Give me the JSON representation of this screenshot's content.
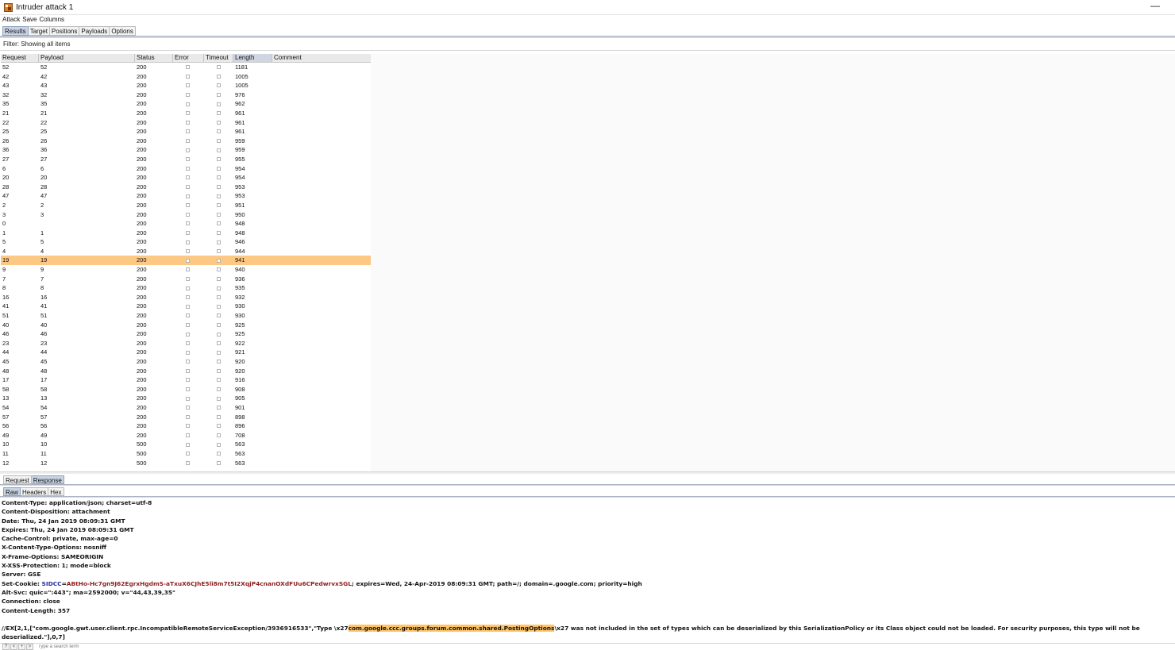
{
  "window": {
    "title": "Intruder attack 1",
    "minimize_label": "—"
  },
  "menu": [
    "Attack",
    "Save",
    "Columns"
  ],
  "tabs": [
    "Results",
    "Target",
    "Positions",
    "Payloads",
    "Options"
  ],
  "filter_text": "Filter: Showing all items",
  "table": {
    "columns": [
      "Request",
      "Payload",
      "Status",
      "Error",
      "Timeout",
      "Length",
      "Comment"
    ],
    "sorted_column": "Length",
    "selected_request": "19",
    "rows": [
      [
        "52",
        "52",
        "200",
        "1181"
      ],
      [
        "42",
        "42",
        "200",
        "1005"
      ],
      [
        "43",
        "43",
        "200",
        "1005"
      ],
      [
        "32",
        "32",
        "200",
        "976"
      ],
      [
        "35",
        "35",
        "200",
        "962"
      ],
      [
        "21",
        "21",
        "200",
        "961"
      ],
      [
        "22",
        "22",
        "200",
        "961"
      ],
      [
        "25",
        "25",
        "200",
        "961"
      ],
      [
        "26",
        "26",
        "200",
        "959"
      ],
      [
        "36",
        "36",
        "200",
        "959"
      ],
      [
        "27",
        "27",
        "200",
        "955"
      ],
      [
        "6",
        "6",
        "200",
        "954"
      ],
      [
        "20",
        "20",
        "200",
        "954"
      ],
      [
        "28",
        "28",
        "200",
        "953"
      ],
      [
        "47",
        "47",
        "200",
        "953"
      ],
      [
        "2",
        "2",
        "200",
        "951"
      ],
      [
        "3",
        "3",
        "200",
        "950"
      ],
      [
        "0",
        "",
        "200",
        "948"
      ],
      [
        "1",
        "1",
        "200",
        "948"
      ],
      [
        "5",
        "5",
        "200",
        "946"
      ],
      [
        "4",
        "4",
        "200",
        "944"
      ],
      [
        "19",
        "19",
        "200",
        "941"
      ],
      [
        "9",
        "9",
        "200",
        "940"
      ],
      [
        "7",
        "7",
        "200",
        "936"
      ],
      [
        "8",
        "8",
        "200",
        "935"
      ],
      [
        "16",
        "16",
        "200",
        "932"
      ],
      [
        "41",
        "41",
        "200",
        "930"
      ],
      [
        "51",
        "51",
        "200",
        "930"
      ],
      [
        "40",
        "40",
        "200",
        "925"
      ],
      [
        "46",
        "46",
        "200",
        "925"
      ],
      [
        "23",
        "23",
        "200",
        "922"
      ],
      [
        "44",
        "44",
        "200",
        "921"
      ],
      [
        "45",
        "45",
        "200",
        "920"
      ],
      [
        "48",
        "48",
        "200",
        "920"
      ],
      [
        "17",
        "17",
        "200",
        "916"
      ],
      [
        "58",
        "58",
        "200",
        "908"
      ],
      [
        "13",
        "13",
        "200",
        "905"
      ],
      [
        "54",
        "54",
        "200",
        "901"
      ],
      [
        "57",
        "57",
        "200",
        "898"
      ],
      [
        "56",
        "56",
        "200",
        "896"
      ],
      [
        "49",
        "49",
        "200",
        "708"
      ],
      [
        "10",
        "10",
        "500",
        "563"
      ],
      [
        "11",
        "11",
        "500",
        "563"
      ],
      [
        "12",
        "12",
        "500",
        "563"
      ]
    ]
  },
  "message_tabs": [
    "Request",
    "Response"
  ],
  "view_tabs": [
    "Raw",
    "Headers",
    "Hex"
  ],
  "response": {
    "headers": [
      "Content-Type: application/json; charset=utf-8",
      "Content-Disposition: attachment",
      "Date: Thu, 24 Jan 2019 08:09:31 GMT",
      "Expires: Thu, 24 Jan 2019 08:09:31 GMT",
      "Cache-Control: private, max-age=0",
      "X-Content-Type-Options: nosniff",
      "X-Frame-Options: SAMEORIGIN",
      "X-XSS-Protection: 1; mode=block",
      "Server: GSE"
    ],
    "cookie": {
      "prefix": "Set-Cookie: ",
      "name": "SIDCC",
      "eq": "=",
      "value": "ABtHo-Hc7gn9J62EgrxHgdmS-aTxuX6CJhE5li8m7t5I2XqjP4cnanOXdFUu6CPedwrvxSGL",
      "rest": "; expires=Wed, 24-Apr-2019 08:09:31 GMT; path=/; domain=.google.com; priority=high"
    },
    "headers_after": [
      "Alt-Svc: quic=\":443\"; ma=2592000; v=\"44,43,39,35\"",
      "Connection: close",
      "Content-Length: 357"
    ],
    "body_before": "//EX[2,1,[\"com.google.gwt.user.client.rpc.IncompatibleRemoteServiceException/3936916533\",\"Type \\x27",
    "body_highlight": "com.google.ccc.groups.forum.common.shared.PostingOptions",
    "body_after": "\\x27 was not included in the set of types which can be deserialized by this SerializationPolicy or its Class object could not be loaded. For security purposes, this type will not be deserialized.\"],0,7]"
  },
  "search": {
    "buttons": [
      "?",
      "<",
      "+",
      ">"
    ],
    "placeholder": "Type a search term"
  },
  "colors": {
    "selected_row": "#fdc784",
    "highlight": "#ffc468",
    "cookie_name": "#1e2f9a",
    "cookie_value": "#8c1c1c"
  }
}
